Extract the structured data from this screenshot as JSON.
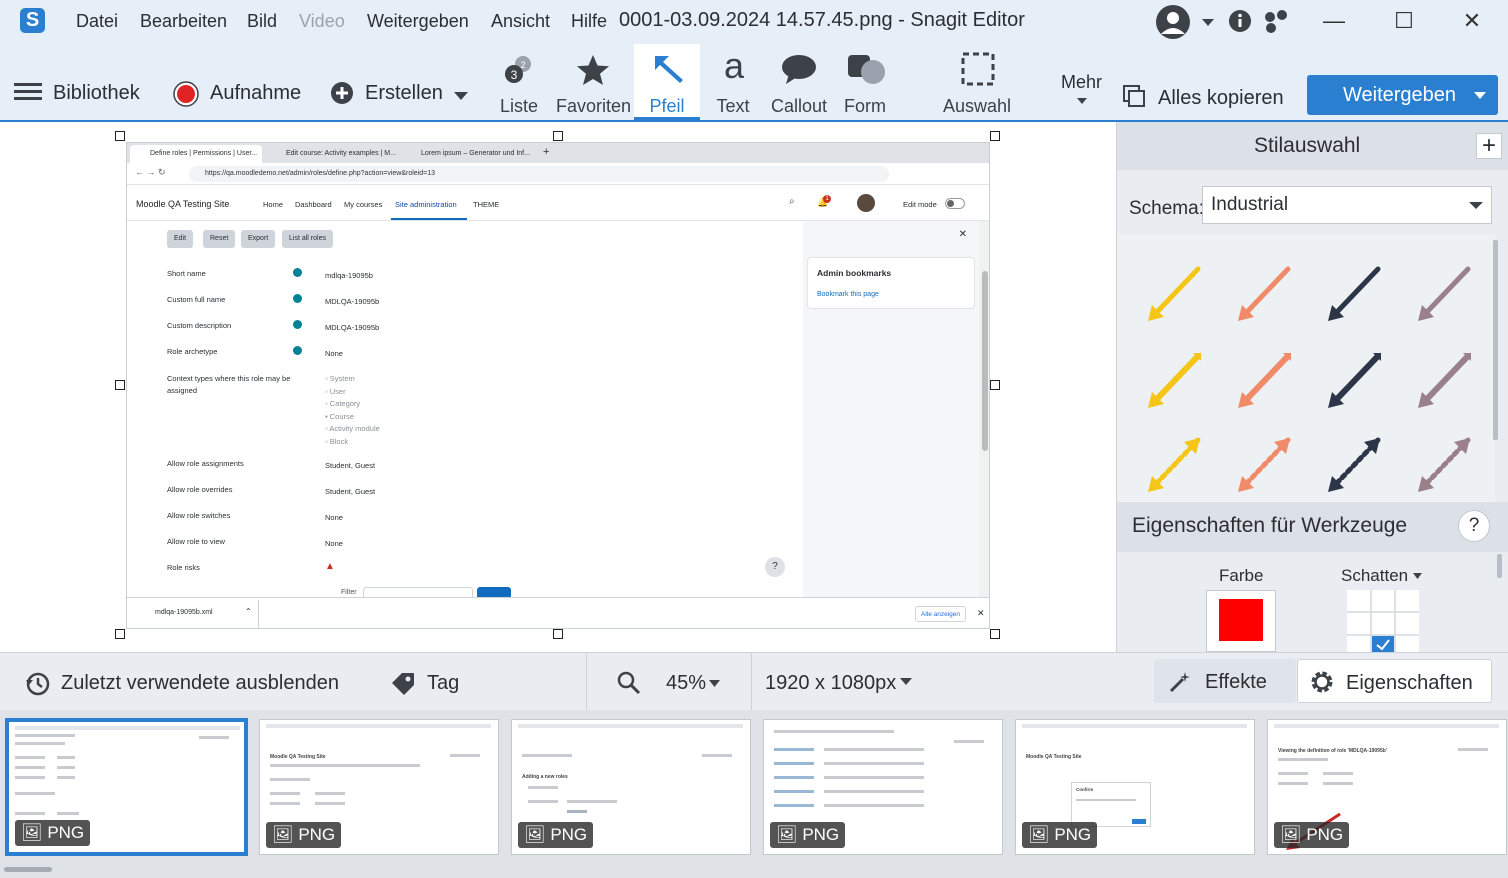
{
  "title_bar": {
    "app_logo": "S",
    "menus": [
      "Datei",
      "Bearbeiten",
      "Bild",
      "Video",
      "Weitergeben",
      "Ansicht",
      "Hilfe"
    ],
    "document_title": "0001-03.09.2024 14.57.45.png - Snagit Editor"
  },
  "toolbar": {
    "library_label": "Bibliothek",
    "capture_label": "Aufnahme",
    "create_label": "Erstellen",
    "tools": [
      {
        "label": "Liste",
        "icon": "steps-icon"
      },
      {
        "label": "Favoriten",
        "icon": "star-icon"
      },
      {
        "label": "Pfeil",
        "icon": "arrow-icon"
      },
      {
        "label": "Text",
        "icon": "text-icon"
      },
      {
        "label": "Callout",
        "icon": "callout-icon"
      },
      {
        "label": "Form",
        "icon": "shape-icon"
      },
      {
        "label": "Auswahl",
        "icon": "selection-icon"
      }
    ],
    "active_tool": "Pfeil",
    "more_label": "Mehr",
    "copy_all_label": "Alles kopieren",
    "share_label": "Weitergeben",
    "step_badges": [
      "3",
      "2"
    ]
  },
  "canvas_browser": {
    "tabs": [
      "Define roles | Permissions | User...",
      "Edit course: Activity examples | M...",
      "Lorem ipsum – Generator und Inf..."
    ],
    "url": "https://qa.moodledemo.net/admin/roles/define.php?action=view&roleid=13",
    "site_name": "Moodle QA Testing Site",
    "nav": [
      "Home",
      "Dashboard",
      "My courses",
      "Site administration",
      "THEME"
    ],
    "edit_mode_label": "Edit mode",
    "notification_badge": "1",
    "buttons": [
      "Edit",
      "Reset",
      "Export",
      "List all roles"
    ],
    "fields": [
      {
        "label": "Short name",
        "value": "mdlqa-19095b"
      },
      {
        "label": "Custom full name",
        "value": "MDLQA-19095b"
      },
      {
        "label": "Custom description",
        "value": "MDLQA-19095b"
      },
      {
        "label": "Role archetype",
        "value": "None"
      }
    ],
    "context_label": "Context types where this role may be assigned",
    "contexts": [
      "System",
      "User",
      "Category",
      "Course",
      "Activity module",
      "Block"
    ],
    "rows": [
      {
        "label": "Allow role assignments",
        "value": "Student, Guest"
      },
      {
        "label": "Allow role overrides",
        "value": "Student, Guest"
      },
      {
        "label": "Allow role switches",
        "value": "None"
      },
      {
        "label": "Allow role to view",
        "value": "None"
      },
      {
        "label": "Role risks",
        "value": ""
      }
    ],
    "filter_label": "Filter",
    "bookmarks_title": "Admin bookmarks",
    "bookmark_link": "Bookmark this page",
    "download_file": "mdlqa-19095b.xml",
    "show_all": "Alle anzeigen"
  },
  "style_panel": {
    "title": "Stilauswahl",
    "schema_label": "Schema:",
    "schema_value": "Industrial",
    "arrow_colors": [
      "#f5c518",
      "#f08a68",
      "#2d3648",
      "#9a8089"
    ]
  },
  "properties_panel": {
    "title": "Eigenschaften für Werkzeuge",
    "color_label": "Farbe",
    "shadow_label": "Schatten",
    "color_value": "#ff0000"
  },
  "bottom_bar": {
    "hide_recent": "Zuletzt verwendete ausblenden",
    "tag": "Tag",
    "zoom": "45%",
    "dimensions": "1920 x 1080px",
    "effects": "Effekte",
    "properties": "Eigenschaften"
  },
  "tray": {
    "thumbnails": [
      {
        "badge": "PNG"
      },
      {
        "badge": "PNG"
      },
      {
        "badge": "PNG"
      },
      {
        "badge": "PNG"
      },
      {
        "badge": "PNG"
      },
      {
        "badge": "PNG"
      }
    ],
    "thumb_texts": [
      "Moodle QA Testing Site",
      "Moodle QA Testing Site",
      "Adding a new roles",
      "Confirm",
      "Viewing the definition of role 'MDLQA-19095b'"
    ]
  },
  "colors": {
    "accent": "#2b7fd0",
    "record": "#e02424"
  }
}
